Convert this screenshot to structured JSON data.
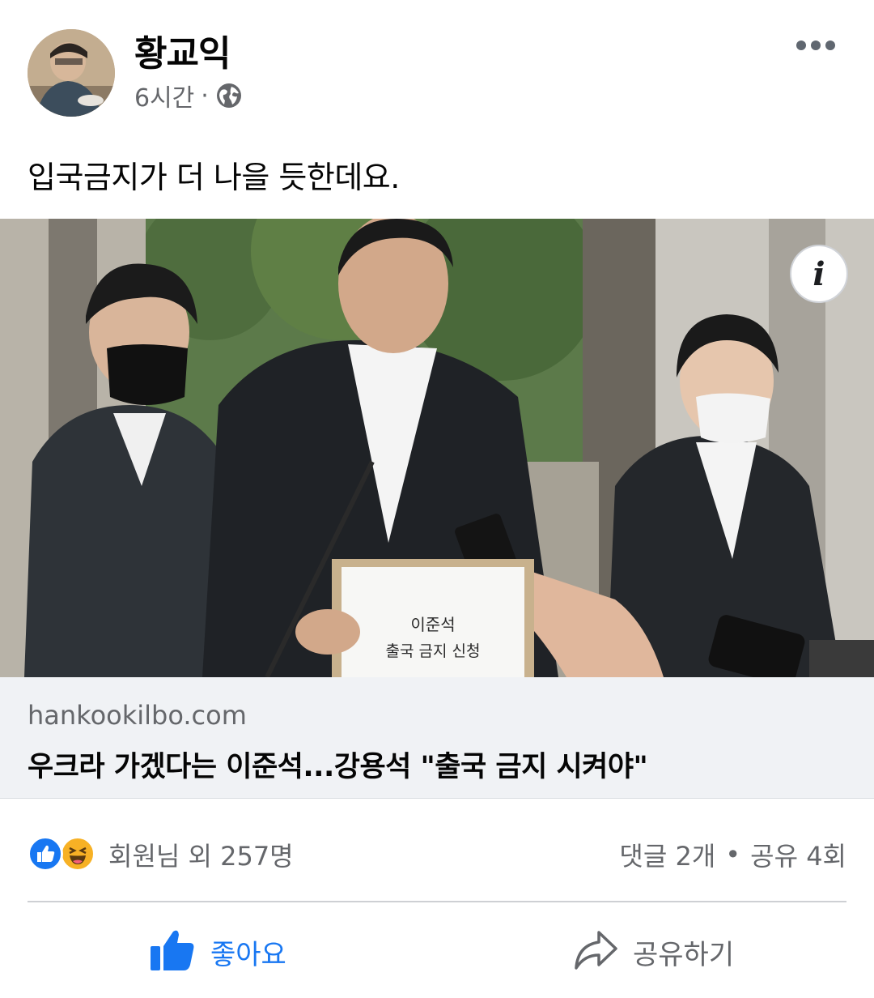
{
  "author": {
    "name": "황교익",
    "time": "6시간",
    "separator": "·",
    "privacy_icon": "globe-icon"
  },
  "post": {
    "text": "입국금지가 더 나을 듯한데요."
  },
  "link_preview": {
    "domain": "hankookilbo.com",
    "title": "우크라 가겠다는 이준석...강용석 \"출국 금지 시켜야\"",
    "sign_line1": "이준석",
    "sign_line2": "출국 금지 신청",
    "info_symbol": "i"
  },
  "reactions": {
    "icons": [
      "like-reaction-icon",
      "haha-reaction-icon"
    ],
    "summary": "회원님 외 257명",
    "comments": "댓글 2개",
    "dot": "•",
    "shares": "공유 4회"
  },
  "actions": {
    "like_label": "좋아요",
    "share_label": "공유하기"
  },
  "colors": {
    "facebook_blue": "#1877f2",
    "secondary_text": "#65676b",
    "link_bg": "#f0f2f5"
  }
}
